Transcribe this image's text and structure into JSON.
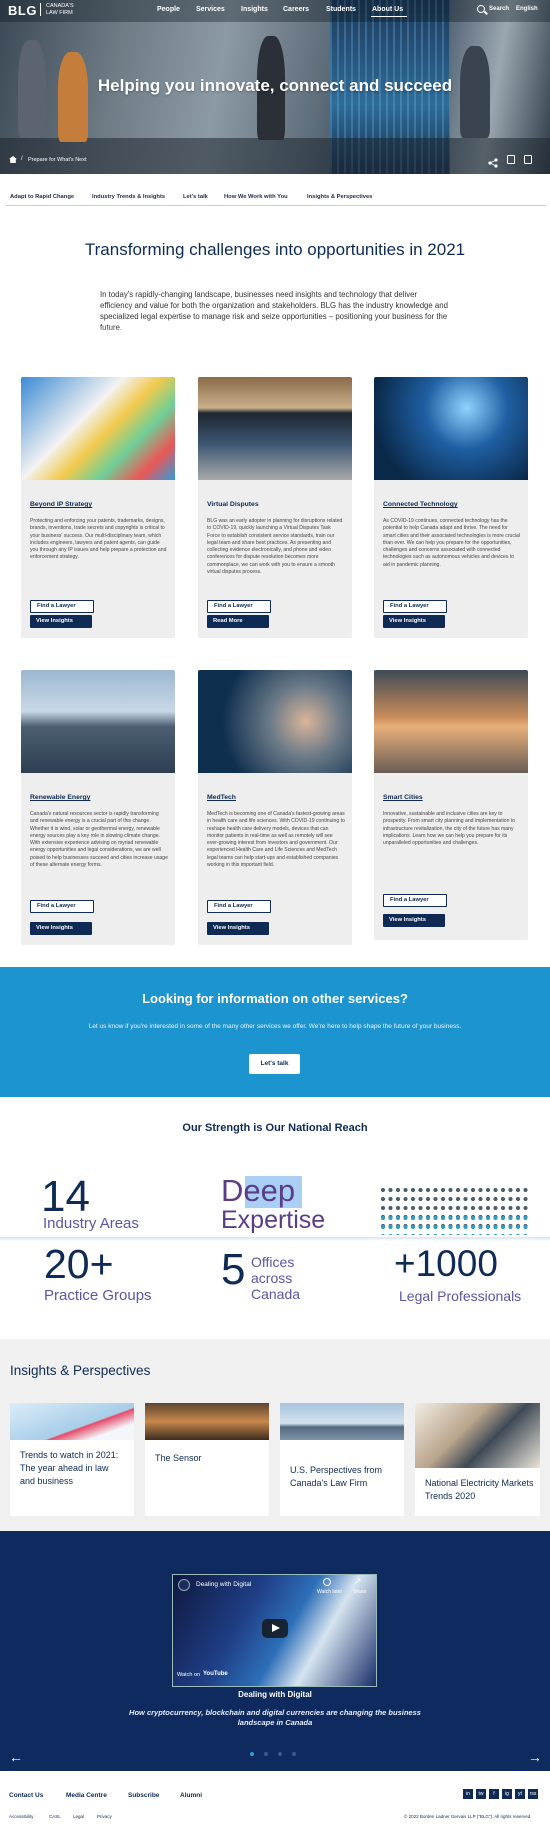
{
  "header": {
    "logo": "BLG",
    "logo_sub": "CANADA'S LAW FIRM",
    "nav": [
      "People",
      "Services",
      "Insights",
      "Careers",
      "Students",
      "About Us"
    ],
    "search_label": "Search",
    "language_label": "English"
  },
  "hero": {
    "title": "Helping you innovate, connect and succeed",
    "breadcrumb_sep": "/",
    "breadcrumb": "Prepare for What's Next"
  },
  "subnav": [
    "Adapt to Rapid Change",
    "Industry Trends & Insights",
    "Let's talk",
    "How We Work with You",
    "Insights & Perspectives"
  ],
  "intro": {
    "title": "Transforming challenges into opportunities in 2021",
    "body": "In today's rapidly-changing landscape, businesses need insights and technology that deliver efficiency and value for both the organization and stakeholders. BLG has the industry knowledge and specialized legal expertise to manage risk and seize opportunities – positioning your business for the future."
  },
  "cards": [
    {
      "title": "Beyond IP Strategy",
      "body": "Protecting and enforcing your patents, trademarks, designs, brands, inventions, trade secrets and copyrights is critical to your business' success. Our multi-disciplinary team, which includes engineers, lawyers and patent agents, can guide you through any IP issues and help prepare a protection and enforcement strategy.",
      "btn1": "Find a Lawyer",
      "btn2": "View Insights"
    },
    {
      "title": "Virtual Disputes",
      "body": "BLG was an early adopter in planning for disruptions related to COVID-19, quickly launching a Virtual Disputes Task Force to establish consistent service standards, train our legal team and share best practices. As presenting and collecting evidence electronically, and phone and video conferences for dispute resolution becomes more commonplace, we can work with you to ensure a smooth virtual disputes process.",
      "btn1": "Find a Lawyer",
      "btn2": "Read More"
    },
    {
      "title": "Connected Technology",
      "body": "As COVID-19 continues, connected technology has the potential to help Canada adapt and thrive. The need for smart cities and their associated technologies is more crucial than ever. We can help you prepare for the opportunities, challenges and concerns associated with connected technologies such as autonomous vehicles and devices to aid in pandemic planning.",
      "btn1": "Find a Lawyer",
      "btn2": "View Insights"
    },
    {
      "title": "Renewable Energy",
      "body": "Canada's natural resources sector is rapidly transforming and renewable energy is a crucial part of this change. Whether it is wind, solar or geothermal energy, renewable energy sources play a key role in slowing climate change. With extensive experience advising on myriad renewable energy opportunities and legal considerations, we are well poised to help businesses succeed and cities increase usage of these alternate energy forms.",
      "btn1": "Find a Lawyer",
      "btn2": "View Insights"
    },
    {
      "title": "MedTech",
      "body": "MedTech is becoming one of Canada's fastest-growing areas in health care and life sciences. With COVID-19 continuing to reshape health care delivery models, devices that can monitor patients in real-time as well as remotely will see ever-growing interest from investors and government. Our experienced Health Care and Life Sciences and MedTech legal teams can help start-ups and established companies working in this important field.",
      "btn1": "Find a Lawyer",
      "btn2": "View Insights"
    },
    {
      "title": "Smart Cities",
      "body": "Innovative, sustainable and inclusive cities are key to prosperity. From smart city planning and implementation to infrastructure revitalization, the city of the future has many implications. Learn how we can help you prepare for its unparalleled opportunities and challenges.",
      "btn1": "Find a Lawyer",
      "btn2": "View Insights"
    }
  ],
  "band": {
    "title": "Looking for information on other services?",
    "text": "Let us know if you're interested in some of the many other services we offer. We're here to help shape the future of your business.",
    "button": "Let's talk"
  },
  "strength": {
    "title": "Our Strength is Our National Reach",
    "s1_num": "14",
    "s1_lbl": "Industry Areas",
    "s2_a": "Deep",
    "s2_b": "Expertise",
    "s4_num": "20+",
    "s4_lbl": "Practice Groups",
    "s5_num": "5",
    "s5_l1": "Offices",
    "s5_l2": "across",
    "s5_l3": "Canada",
    "s6_num": "+1000",
    "s6_lbl": "Legal Professionals"
  },
  "insights": {
    "heading": "Insights & Perspectives",
    "items": [
      "Trends to watch in 2021: The year ahead in law and business",
      "The Sensor",
      "U.S. Perspectives from Canada's Law Firm",
      "National Electricity Markets Trends 2020"
    ]
  },
  "video": {
    "title": "Dealing with Digital",
    "watch_later": "Watch later",
    "share": "Share",
    "watch_on": "Watch on",
    "youtube": "YouTube",
    "caption": "Dealing with Digital",
    "subtitle": "How cryptocurrency, blockchain and digital currencies are changing the business landscape in Canada"
  },
  "footer": {
    "links": [
      "Contact Us",
      "Media Centre",
      "Subscribe",
      "Alumni"
    ],
    "social": [
      "in",
      "tw",
      "f",
      "ig",
      "yt",
      "rss"
    ],
    "small": [
      "Accessibility",
      "CASL",
      "Legal",
      "Privacy"
    ],
    "copyright": "© 2022 Borden Ladner Gervais LLP (\"BLG\"). All rights reserved."
  },
  "colors": {
    "navy": "#0e2a55",
    "band": "#1b94cf",
    "video_bg": "#0e2a5f"
  }
}
